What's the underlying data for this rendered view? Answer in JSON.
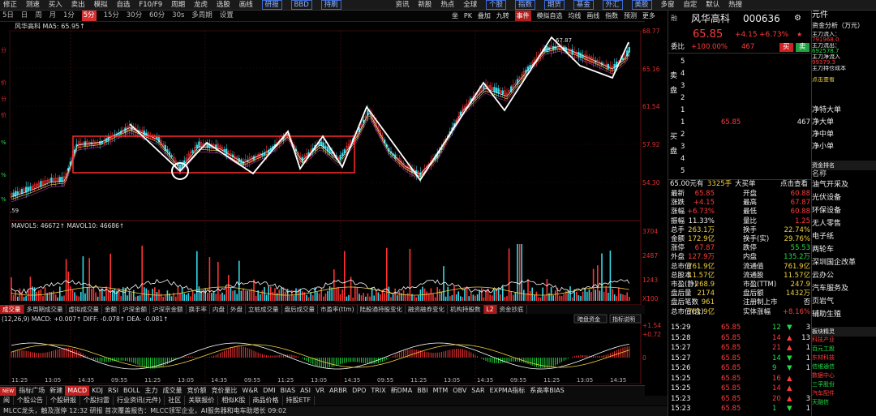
{
  "toolbar": {
    "items": [
      "修正",
      "测速",
      "买入",
      "卖出",
      "模拟",
      "自选",
      "F10/F9",
      "周期",
      "龙虎",
      "选股",
      "画线"
    ],
    "boxed": [
      "研报",
      "BBD",
      "持刷"
    ],
    "right_items": [
      "个股",
      "指数",
      "期货",
      "基金",
      "外汇",
      "美股",
      "多窗",
      "自定",
      "默认",
      "热搜"
    ],
    "left_items": [
      "资讯",
      "新股",
      "热点",
      "全球"
    ]
  },
  "period_bar": {
    "items": [
      "5日",
      "日",
      "周",
      "月",
      "1分",
      "5分",
      "15分",
      "30分",
      "60分",
      "30s",
      "多周期",
      "设置"
    ],
    "selected": "5分",
    "right_tools": [
      "坐",
      "PK",
      "叠加",
      "九转",
      "事件",
      "模拟自选",
      "均线",
      "画线",
      "指数",
      "预测",
      "更多"
    ],
    "right_selected": "事件"
  },
  "chart": {
    "info": "风华高科 MA5: 65.95↑",
    "price_ticks": [
      "68.77",
      "65.16",
      "61.54",
      "57.92",
      "54.30"
    ],
    "high_label": "67.87",
    "low_label": ".59",
    "volume_info": "MAVOL5: 46672↑  MAVOL10: 46686↑",
    "volume_ticks": [
      "3704",
      "2487",
      "1243",
      "X100"
    ],
    "macd_info": "(12,26,9) MACD: +0.007↑  DIFF: -0.078↑  DEA: -0.081↑",
    "macd_ticks": [
      "+1.54",
      "+0.72",
      "0"
    ],
    "macd_buttons": [
      "暗盘资金",
      "指标说明"
    ],
    "time_ticks": [
      "11:25",
      "13:05",
      "14:35",
      "09:55",
      "11:25",
      "13:05",
      "14:35",
      "09:55",
      "11:25",
      "13:05",
      "14:35",
      "09:55",
      "11:25",
      "13:05",
      "14:35",
      "09:55",
      "11:25",
      "13:05",
      "14:35"
    ],
    "left_axis_labels": [
      "K线",
      "分",
      "价",
      "分",
      "价",
      "%",
      "%",
      "%"
    ]
  },
  "indicator_tabs": {
    "items": [
      "成交量",
      "多周期成交量",
      "虚拟成交量",
      "金额",
      "沪深金额",
      "沪深京金额",
      "换手率",
      "内盘",
      "外盘",
      "立桩成交量",
      "盘后成交量",
      "市盈率(ttm)",
      "陆股通持股变化",
      "融资融券变化",
      "机构持股数",
      "L2",
      "资金抄底"
    ],
    "selected": "成交量"
  },
  "bottom_tabs": {
    "items": [
      "NEW",
      "指标广场",
      "新建",
      "MACD",
      "KDJ",
      "RSI",
      "BOLL",
      "主力",
      "成交量",
      "竞价额",
      "竞价量比",
      "W&R",
      "DMI",
      "BIAS",
      "ASI",
      "VR",
      "ARBR",
      "DPO",
      "TRIX",
      "新DMA",
      "BBI",
      "MTM",
      "OBV",
      "SAR",
      "EXPMA指标",
      "系高率BIAS"
    ],
    "selected": "MACD"
  },
  "footer_tabs": [
    "阅",
    "个股公告",
    "个股研报",
    "个股扫雷",
    "行业资讯(元件)",
    "社区",
    "关联报价",
    "相似K股",
    "商品价格",
    "持股ETF"
  ],
  "news": "MLCC龙头，触及涨停    12:32  研报  首次覆盖报告：MLCC领军企业，AI服务器和电车助增长    09:02",
  "quote": {
    "name": "风华高科",
    "code": "000636",
    "price": "65.85",
    "change": "+4.15",
    "change_pct": "+6.73%",
    "margin_tag": "融",
    "weibi_label": "委比",
    "weibi": "+100.00%",
    "weicha": "467",
    "buy_btn": "买",
    "sell_btn": "卖",
    "sell_label": "卖盘",
    "buy_label": "买盘",
    "asks": [
      {
        "n": "5",
        "p": "",
        "v": ""
      },
      {
        "n": "4",
        "p": "",
        "v": ""
      },
      {
        "n": "3",
        "p": "",
        "v": ""
      },
      {
        "n": "2",
        "p": "",
        "v": ""
      },
      {
        "n": "1",
        "p": "",
        "v": ""
      }
    ],
    "bids": [
      {
        "n": "1",
        "p": "65.85",
        "v": "467"
      },
      {
        "n": "2",
        "p": "",
        "v": ""
      },
      {
        "n": "3",
        "p": "",
        "v": ""
      },
      {
        "n": "4",
        "p": "",
        "v": ""
      },
      {
        "n": "5",
        "p": "",
        "v": ""
      }
    ],
    "summary_line": {
      "price": "65.00元有",
      "amount": "3325手",
      "label": "大买单",
      "link": "点击查看"
    },
    "stats": [
      {
        "l1": "最新",
        "v1": "65.85",
        "c1": "red",
        "l2": "开盘",
        "v2": "60.88",
        "c2": "red"
      },
      {
        "l1": "涨跌",
        "v1": "+4.15",
        "c1": "red",
        "l2": "最高",
        "v2": "67.87",
        "c2": "red"
      },
      {
        "l1": "涨幅",
        "v1": "+6.73%",
        "c1": "red",
        "l2": "最低",
        "v2": "60.88",
        "c2": "red"
      },
      {
        "l1": "振幅",
        "v1": "11.33%",
        "c1": "white",
        "l2": "量比",
        "v2": "1.25",
        "c2": "red"
      },
      {
        "l1": "总手",
        "v1": "263.1万",
        "c1": "yellow",
        "l2": "换手",
        "v2": "22.74%",
        "c2": "yellow"
      },
      {
        "l1": "金额",
        "v1": "172.9亿",
        "c1": "yellow",
        "l2": "换手(实)",
        "v2": "29.76%",
        "c2": "yellow"
      },
      {
        "l1": "涨停",
        "v1": "67.87",
        "c1": "red",
        "l2": "跌停",
        "v2": "55.53",
        "c2": "green"
      },
      {
        "l1": "外盘",
        "v1": "127.9万",
        "c1": "red",
        "l2": "内盘",
        "v2": "135.2万",
        "c2": "green"
      },
      {
        "l1": "总市值",
        "v1": "761.9亿",
        "c1": "yellow",
        "l2": "流通值",
        "v2": "761.9亿",
        "c2": "yellow"
      },
      {
        "l1": "总股本",
        "v1": "11.57亿",
        "c1": "yellow",
        "l2": "流通股",
        "v2": "11.57亿",
        "c2": "yellow"
      },
      {
        "l1": "市盈(静)",
        "v1": "268.9",
        "c1": "yellow",
        "l2": "市盈(TTM)",
        "v2": "247.9",
        "c2": "yellow"
      },
      {
        "l1": "盘后量",
        "v1": "2174",
        "c1": "yellow",
        "l2": "盘后额",
        "v2": "1432万",
        "c2": "yellow"
      },
      {
        "l1": "盘后笔数",
        "v1": "961",
        "c1": "yellow",
        "l2": "注册制上市",
        "v2": "否",
        "c2": "white"
      },
      {
        "l1": "总市值(含)",
        "v1": "761.9亿",
        "c1": "yellow",
        "l2": "实体涨幅",
        "v2": "+8.16%",
        "c2": "red"
      }
    ],
    "ticks": [
      {
        "t": "15:29",
        "p": "65.85",
        "v": "12",
        "d": "down"
      },
      {
        "t": "15:28",
        "p": "65.85",
        "v": "14",
        "d": "up"
      },
      {
        "t": "15:27",
        "p": "65.85",
        "v": "21",
        "d": "up"
      },
      {
        "t": "15:27",
        "p": "65.85",
        "v": "14",
        "d": "down"
      },
      {
        "t": "15:26",
        "p": "65.85",
        "v": "9",
        "d": "down"
      },
      {
        "t": "15:25",
        "p": "65.85",
        "v": "16",
        "d": "up"
      },
      {
        "t": "15:25",
        "p": "65.85",
        "v": "14",
        "d": "up"
      },
      {
        "t": "15:23",
        "p": "65.85",
        "v": "20",
        "d": "up"
      },
      {
        "t": "15:23",
        "p": "65.85",
        "v": "1",
        "d": "down"
      }
    ],
    "tick_side_nums": [
      "3",
      "13",
      "1",
      "1",
      "1",
      "",
      "",
      "3",
      "1"
    ]
  },
  "side_panel": {
    "header": "元件",
    "flow_title": "资金分析（万元）",
    "flow_items": [
      {
        "label": "主力流入：",
        "value": "791968.0",
        "color": "red"
      },
      {
        "label": "主力流出：",
        "value": "692578.7",
        "color": "green"
      },
      {
        "label": "主力净流入",
        "value": "99379.3",
        "color": "red"
      },
      {
        "label": "主力持仓成本",
        "value": "",
        "color": "white"
      },
      {
        "label": "点击查看",
        "value": "",
        "color": "yellow"
      }
    ],
    "net_items": [
      "净特大单",
      "净大单",
      "净中单",
      "净小单"
    ],
    "rank_title": "资金排名",
    "rank_col": "名称",
    "rank_items": [
      "油气开采及",
      "光伏设备",
      "环保设备",
      "无人零售",
      "电子纸",
      "两轮车",
      "深圳国企改革",
      "云办公",
      "汽车服务及",
      "页岩气",
      "辅助生殖"
    ],
    "bottom_title": "板块精灵",
    "bottom_items": [
      "科技产业",
      "百元工股",
      "东材科技",
      "信维通信",
      "数据中心",
      "三孚股份",
      "汽车配件",
      "天融信"
    ]
  }
}
